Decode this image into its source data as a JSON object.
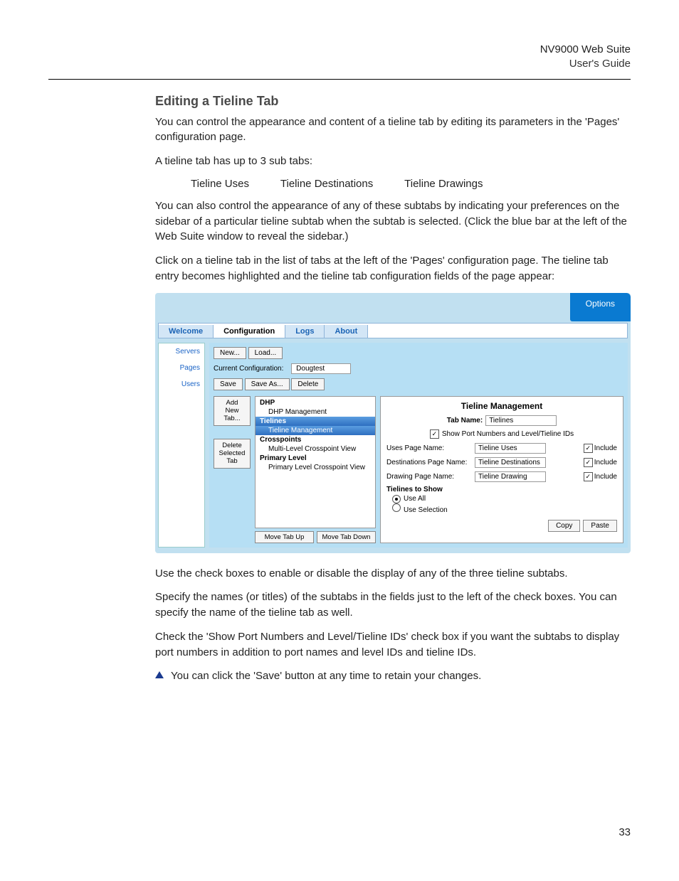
{
  "header": {
    "title": "NV9000 Web Suite",
    "subtitle": "User's Guide"
  },
  "section_heading": "Editing a Tieline Tab",
  "para1": "You can control the appearance and content of a tieline tab by editing its parameters in the 'Pages' configuration page.",
  "para2": "A tieline tab has up to 3 sub tabs:",
  "subtabs": {
    "a": "Tieline Uses",
    "b": "Tieline Destinations",
    "c": "Tieline Drawings"
  },
  "para3": "You can also control the appearance of any of these subtabs by indicating your preferences on the sidebar of a particular tieline subtab when the subtab is selected. (Click the blue bar at the left of the Web Suite window to reveal the sidebar.)",
  "para4": "Click on a tieline tab in the list of tabs at the left of the 'Pages' configuration page. The tieline tab entry becomes highlighted and the tieline tab configuration fields of the page appear:",
  "para5": "Use the check boxes to enable or disable the display of any of the three tieline subtabs.",
  "para6": "Specify the names (or titles) of the subtabs in the fields just to the left of the check boxes. You can specify the name of the tieline tab as well.",
  "para7": "Check the 'Show Port Numbers and Level/Tieline IDs' check box if you want the subtabs to display port numbers in addition to port names and level IDs and tieline IDs.",
  "note": "You can click the 'Save' button at any time to retain your changes.",
  "page_number": "33",
  "figure": {
    "options": "Options",
    "tabs": {
      "welcome": "Welcome",
      "configuration": "Configuration",
      "logs": "Logs",
      "about": "About"
    },
    "left_nav": {
      "servers": "Servers",
      "pages": "Pages",
      "users": "Users"
    },
    "toolbar": {
      "new": "New...",
      "load": "Load...",
      "cfg_label": "Current Configuration:",
      "cfg_value": "Dougtest",
      "save": "Save",
      "save_as": "Save As...",
      "delete": "Delete"
    },
    "colA": {
      "add": "Add\nNew\nTab...",
      "del": "Delete\nSelected\nTab"
    },
    "tree": {
      "g1": "DHP",
      "i1": "DHP Management",
      "g2": "Tielines",
      "i2": "Tieline Management",
      "g3": "Crosspoints",
      "i3": "Multi-Level Crosspoint View",
      "g4": "Primary Level",
      "i4": "Primary Level Crosspoint View",
      "move_up": "Move Tab Up",
      "move_down": "Move Tab Down"
    },
    "panel": {
      "title": "Tieline Management",
      "tabname_label": "Tab Name:",
      "tabname_value": "Tielines",
      "show_port": "Show Port Numbers and Level/Tieline IDs",
      "uses_label": "Uses Page Name:",
      "uses_value": "Tieline Uses",
      "dest_label": "Destinations Page Name:",
      "dest_value": "Tieline Destinations",
      "draw_label": "Drawing Page Name:",
      "draw_value": "Tieline Drawing",
      "include": "Include",
      "tielines_to_show": "Tielines to Show",
      "use_all": "Use All",
      "use_selection": "Use Selection",
      "copy": "Copy",
      "paste": "Paste"
    }
  }
}
